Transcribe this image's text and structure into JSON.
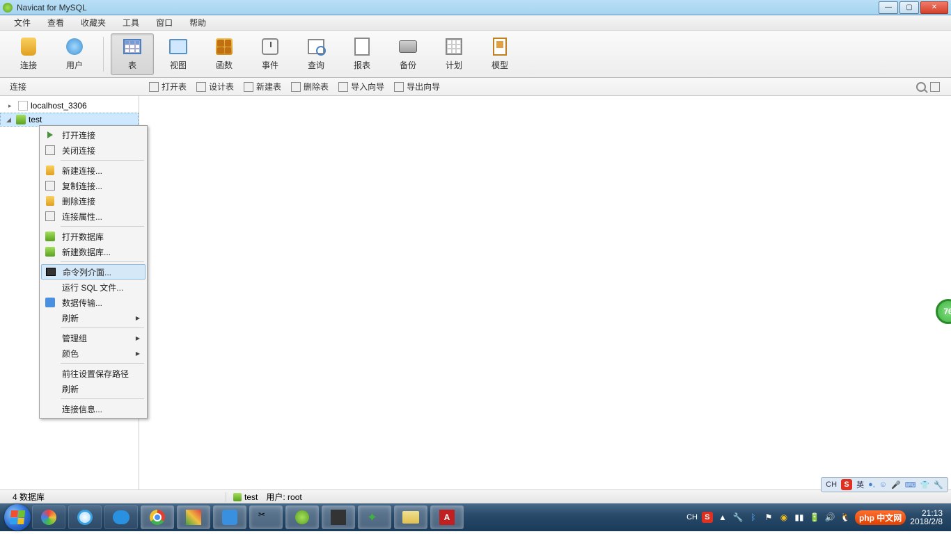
{
  "window": {
    "title": "Navicat for MySQL"
  },
  "menu": {
    "items": [
      "文件",
      "查看",
      "收藏夹",
      "工具",
      "窗口",
      "帮助"
    ]
  },
  "toolbar": {
    "连接": "连接",
    "用户": "用户",
    "表": "表",
    "视图": "视图",
    "函数": "函数",
    "事件": "事件",
    "查询": "查询",
    "报表": "报表",
    "备份": "备份",
    "计划": "计划",
    "模型": "模型"
  },
  "subtoolbar": {
    "left_label": "连接",
    "打开表": "打开表",
    "设计表": "设计表",
    "新建表": "新建表",
    "删除表": "删除表",
    "导入向导": "导入向导",
    "导出向导": "导出向导"
  },
  "tree": {
    "connection": "localhost_3306",
    "database": "test"
  },
  "context_menu": {
    "打开连接": "打开连接",
    "关闭连接": "关闭连接",
    "新建连接": "新建连接...",
    "复制连接": "复制连接...",
    "删除连接": "删除连接",
    "连接属性": "连接属性...",
    "打开数据库": "打开数据库",
    "新建数据库": "新建数据库...",
    "命令列介面": "命令列介面...",
    "运行SQL文件": "运行 SQL 文件...",
    "数据传输": "数据传输...",
    "刷新": "刷新",
    "管理组": "管理组",
    "颜色": "颜色",
    "前往设置保存路径": "前往设置保存路径",
    "刷新2": "刷新",
    "连接信息": "连接信息..."
  },
  "statusbar": {
    "db_count": "4 数据库",
    "current_db": "test",
    "user_label": "用户: root"
  },
  "lang_bar": {
    "ch": "CH",
    "ime": "英"
  },
  "badge": {
    "value": "76"
  },
  "clock": {
    "time": "21:13",
    "date": "2018/2/8"
  },
  "php_badge": {
    "text": "php 中文网"
  }
}
